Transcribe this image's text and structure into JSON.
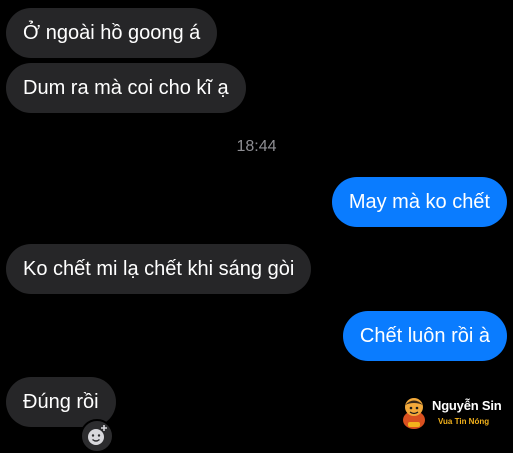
{
  "chat": {
    "messages": [
      {
        "direction": "incoming",
        "text": "Ở ngoài hồ goong á"
      },
      {
        "direction": "incoming",
        "text": "Dum ra mà coi cho kĩ ạ"
      },
      {
        "direction": "outgoing",
        "text": "May mà ko chết"
      },
      {
        "direction": "incoming",
        "text": "Ko chết mi lạ chết khi sáng gòi"
      },
      {
        "direction": "outgoing",
        "text": "Chết luôn rồi à"
      },
      {
        "direction": "incoming",
        "text": "Đúng rồi"
      }
    ],
    "timestamp": "18:44",
    "reaction_icon": "add-reaction-icon"
  },
  "colors": {
    "background": "#000000",
    "incoming_bubble": "#262628",
    "outgoing_bubble": "#0a7cff",
    "timestamp": "#8e8e93"
  },
  "watermark": {
    "name": "Nguyễn Sin",
    "tagline": "Vua Tin Nóng",
    "logo_icon": "mascot-logo-icon"
  }
}
